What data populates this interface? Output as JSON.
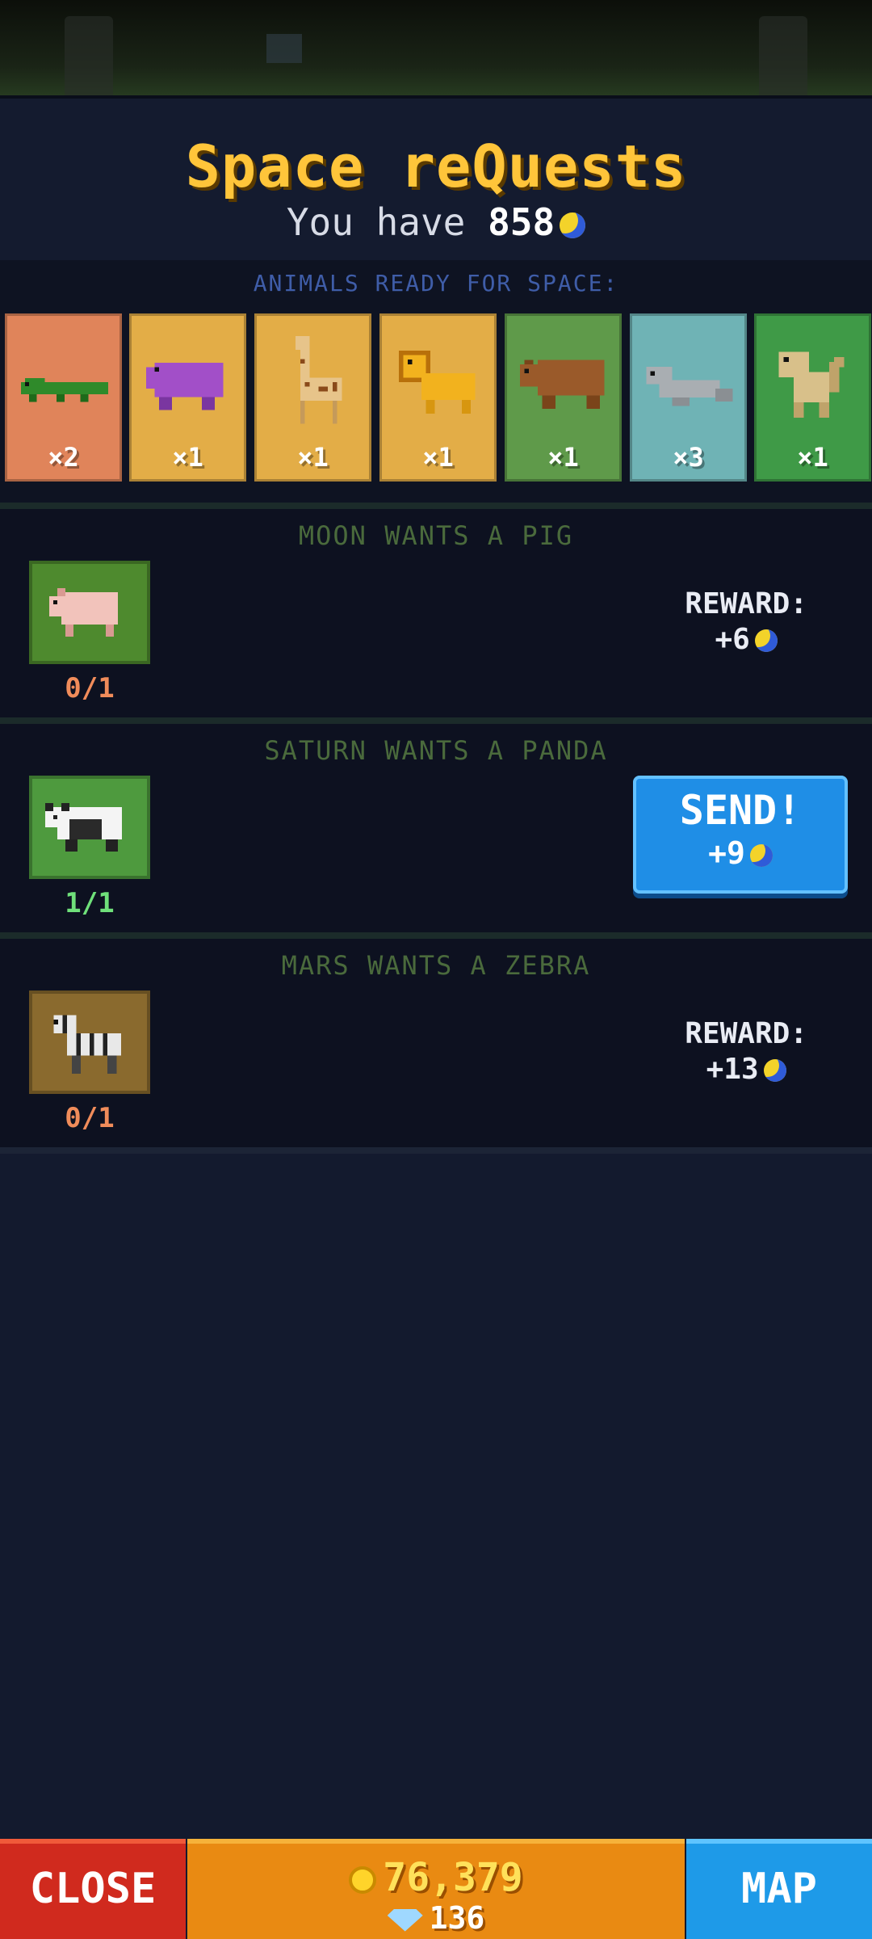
{
  "header": {
    "title": "Space reQuests",
    "have_prefix": "You have",
    "balance": "858",
    "currency_icon": "moon-token-icon"
  },
  "ready": {
    "label": "ANIMALS READY FOR SPACE:",
    "cards": [
      {
        "animal": "crocodile",
        "count": "×2",
        "color": "#e0845a"
      },
      {
        "animal": "hippo",
        "count": "×1",
        "color": "#e3ad47"
      },
      {
        "animal": "giraffe",
        "count": "×1",
        "color": "#e3ad47"
      },
      {
        "animal": "lion",
        "count": "×1",
        "color": "#e3ad47"
      },
      {
        "animal": "bear",
        "count": "×1",
        "color": "#5f9a4a"
      },
      {
        "animal": "seal",
        "count": "×3",
        "color": "#6fb3b5"
      },
      {
        "animal": "monkey",
        "count": "×1",
        "color": "#3f9a47"
      }
    ]
  },
  "quests": [
    {
      "title": "MOON WANTS A PIG",
      "animal": "pig",
      "progress": "0/1",
      "progress_color": "#f08c5a",
      "tile_color": "#4e8a2e",
      "reward_label": "REWARD:",
      "reward_value": "+6"
    },
    {
      "title": "SATURN WANTS A PANDA",
      "animal": "panda",
      "progress": "1/1",
      "progress_color": "#6fe07a",
      "tile_color": "#4e9a3e",
      "send_label": "SEND!",
      "reward_value": "+9"
    },
    {
      "title": "MARS WANTS A ZEBRA",
      "animal": "zebra",
      "progress": "0/1",
      "progress_color": "#f08c5a",
      "tile_color": "#8a6a2e",
      "reward_label": "REWARD:",
      "reward_value": "+13"
    }
  ],
  "bottom": {
    "close_label": "CLOSE",
    "coins": "76,379",
    "gems": "136",
    "map_label": "MAP"
  }
}
